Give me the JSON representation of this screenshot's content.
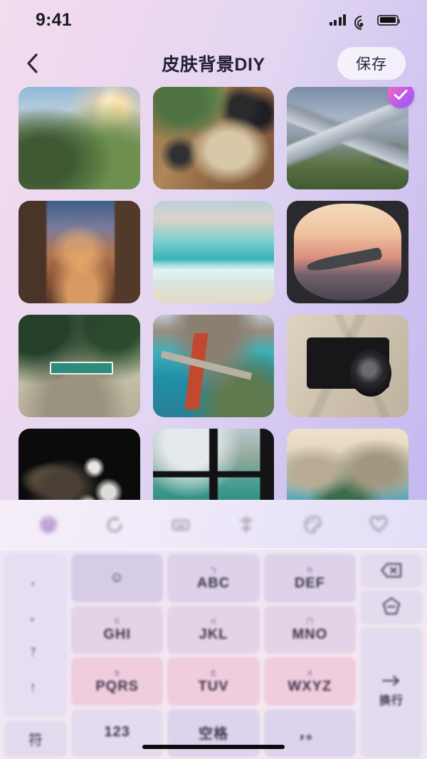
{
  "status_bar": {
    "time": "9:41",
    "icons": [
      "cellular-signal-icon",
      "wifi-icon",
      "battery-icon"
    ]
  },
  "nav": {
    "back_icon": "chevron-left-icon",
    "title": "皮肤背景DIY",
    "save_label": "保存"
  },
  "grid": {
    "selected_index": 2,
    "check_icon": "check-icon",
    "items": [
      {
        "name": "green-valley-sunrise",
        "art": "p-valley",
        "selected": false
      },
      {
        "name": "travel-desk-flatlay",
        "art": "p-desk",
        "selected": false
      },
      {
        "name": "mountain-peaks-hiker",
        "art": "p-peaks",
        "selected": true
      },
      {
        "name": "kyoto-street-pagoda",
        "art": "p-kyoto",
        "selected": false
      },
      {
        "name": "turquoise-beach",
        "art": "p-beach",
        "selected": false
      },
      {
        "name": "airplane-window-wing",
        "art": "p-plane",
        "selected": false
      },
      {
        "name": "palm-street-sign",
        "art": "p-palm",
        "selected": false
      },
      {
        "name": "golden-gate-bridge",
        "art": "p-bridge",
        "selected": false
      },
      {
        "name": "vintage-camera-map",
        "art": "p-cam",
        "selected": false
      },
      {
        "name": "backpack-dark-flatlay",
        "art": "p-bag",
        "selected": false
      },
      {
        "name": "lake-window-boat",
        "art": "p-window",
        "selected": false
      },
      {
        "name": "rio-coastline",
        "art": "p-rio",
        "selected": false
      }
    ]
  },
  "toolbar": {
    "items": [
      {
        "name": "sticker-icon",
        "active": true
      },
      {
        "name": "refresh-icon",
        "active": false
      },
      {
        "name": "keyboard-icon",
        "active": false
      },
      {
        "name": "adjust-icon",
        "active": false
      },
      {
        "name": "palette-icon",
        "active": false
      },
      {
        "name": "heart-icon",
        "active": false
      }
    ]
  },
  "keyboard": {
    "left_column": {
      "punct_key": {
        "name": "punctuation-key",
        "lines": [
          "，",
          "。",
          "？",
          "！"
        ]
      },
      "symbol_key": {
        "name": "symbol-key",
        "label": "符"
      }
    },
    "rows": [
      [
        {
          "name": "key-emoji",
          "main": "☺",
          "sub": "",
          "style": "k-lav"
        },
        {
          "name": "key-abc",
          "main": "ABC",
          "sub": "ㄅ",
          "style": "k-lav2"
        },
        {
          "name": "key-def",
          "main": "DEF",
          "sub": "ㄉ",
          "style": "k-lav2"
        }
      ],
      [
        {
          "name": "key-ghi",
          "main": "GHI",
          "sub": "ㄍ",
          "style": "k-pink1"
        },
        {
          "name": "key-jkl",
          "main": "JKL",
          "sub": "ㄐ",
          "style": "k-pink1"
        },
        {
          "name": "key-mno",
          "main": "MNO",
          "sub": "ㄇ",
          "style": "k-pink1"
        }
      ],
      [
        {
          "name": "key-pqrs",
          "main": "PQRS",
          "sub": "ㄆ",
          "style": "k-pink3"
        },
        {
          "name": "key-tuv",
          "main": "TUV",
          "sub": "ㄊ",
          "style": "k-pink3"
        },
        {
          "name": "key-wxyz",
          "main": "WXYZ",
          "sub": "ㄨ",
          "style": "k-pink3"
        }
      ],
      [
        {
          "name": "key-123",
          "main": "123",
          "sub": "",
          "style": "k-fn"
        },
        {
          "name": "key-spacebar",
          "main": "空格",
          "sub": "",
          "style": "k-fn2"
        },
        {
          "name": "key-comma",
          "main": "，。",
          "sub": "",
          "style": "k-fn2"
        }
      ]
    ],
    "right_column": [
      {
        "name": "backspace-key",
        "icon": "backspace-icon"
      },
      {
        "name": "mode-key",
        "icon": "star-shape-icon"
      },
      {
        "name": "enter-key",
        "icon": "enter-icon",
        "label": "换行"
      }
    ]
  },
  "home_indicator": "home-indicator"
}
